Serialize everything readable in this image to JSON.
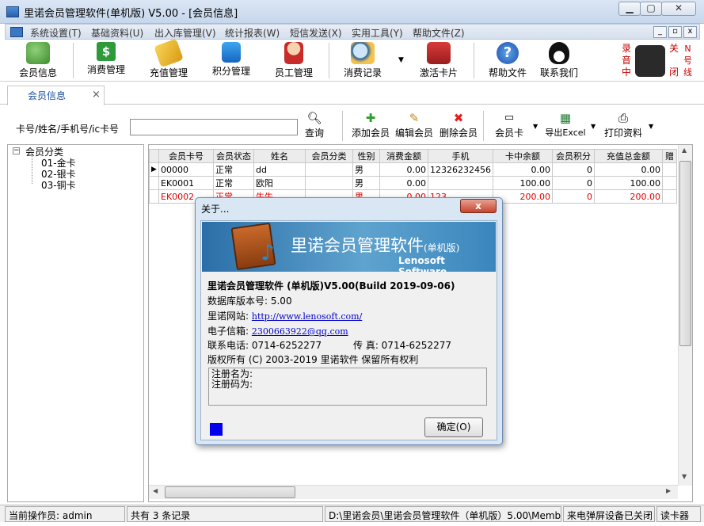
{
  "window": {
    "title": "里诺会员管理软件(单机版) V5.00 - [会员信息]"
  },
  "menu": [
    "系统设置(T)",
    "基础资料(U)",
    "出入库管理(V)",
    "统计报表(W)",
    "短信发送(X)",
    "实用工具(Y)",
    "帮助文件(Z)"
  ],
  "toolbar": {
    "member_info": "会员信息",
    "consume_mgmt": "消费管理",
    "recharge_mgmt": "充值管理",
    "points_mgmt": "积分管理",
    "staff_mgmt": "员工管理",
    "consume_records": "消费记录",
    "activate_card": "激活卡片",
    "help_file": "帮助文件",
    "contact_us": "联系我们",
    "record_on": [
      "录",
      "音",
      "中"
    ],
    "record_off": [
      "关",
      "闭"
    ],
    "number_display": [
      "N",
      "号",
      "线"
    ]
  },
  "tab": {
    "label": "会员信息",
    "close": "×"
  },
  "search": {
    "label": "卡号/姓名/手机号/ic卡号",
    "value": "",
    "button": "查询"
  },
  "actions": {
    "add": "添加会员",
    "edit": "编辑会员",
    "delete": "删除会员",
    "card": "会员卡",
    "export": "导出Excel",
    "print": "打印资料"
  },
  "tree": {
    "root": "会员分类",
    "children": [
      "01-金卡",
      "02-银卡",
      "03-铜卡"
    ]
  },
  "grid": {
    "columns": [
      "会员卡号",
      "会员状态",
      "姓名",
      "会员分类",
      "性别",
      "消费金额",
      "手机",
      "卡中余额",
      "会员积分",
      "充值总金额",
      "赠"
    ],
    "rows": [
      [
        "00000",
        "正常",
        "dd",
        "",
        "男",
        "0.00",
        "12326232456",
        "0.00",
        "0",
        "0.00",
        ""
      ],
      [
        "EK0001",
        "正常",
        "欧阳",
        "",
        "男",
        "0.00",
        "",
        "100.00",
        "0",
        "100.00",
        ""
      ],
      [
        "EK0002",
        "正常",
        "牛牛",
        "",
        "男",
        "0.00",
        "123",
        "200.00",
        "0",
        "200.00",
        ""
      ]
    ]
  },
  "status": {
    "operator": "当前操作员: admin",
    "count": "共有 3 条记录",
    "path": "D:\\里诺会员\\里诺会员管理软件（单机版）5.00\\Memb",
    "caller": "来电弹屏设备已关闭",
    "reader": "读卡器"
  },
  "dialog": {
    "title": "关于...",
    "close": "x",
    "banner_title": "里诺会员管理软件",
    "banner_edition": "(单机版)",
    "banner_sub": "Lenosoft Software",
    "product": "里诺会员管理软件 (单机版)V5.00(Build 2019-09-06)",
    "db_version": "数据库版本号: 5.00",
    "website_label": "里诺网站:",
    "website_url": "http://www.lenosoft.com/",
    "email_label": "电子信箱:",
    "email": "2300663922@qq.com",
    "phone": "联系电话:  0714-6252277",
    "fax": "传    真:  0714-6252277",
    "copyright": "版权所有 (C) 2003-2019 里诺软件 保留所有权利",
    "reg_name": "注册名为:",
    "reg_code": "注册码为:",
    "ok": "确定(O)"
  }
}
